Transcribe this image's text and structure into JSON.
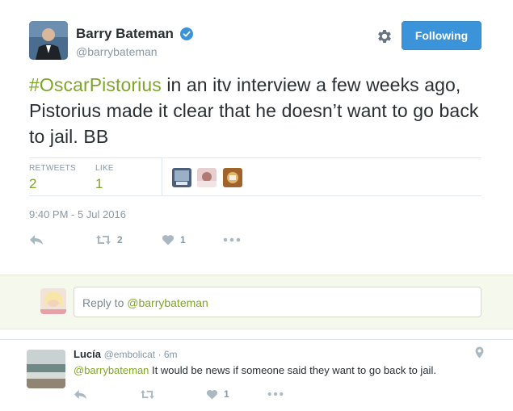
{
  "author": {
    "name": "Barry Bateman",
    "handle": "@barrybateman",
    "verified": true,
    "follow_label": "Following"
  },
  "tweet": {
    "hashtag": "#OscarPistorius",
    "text": " in an itv interview a few weeks ago, Pistorius made it clear that he doesn’t want to go back to jail. BB",
    "timestamp": "9:40 PM - 5 Jul 2016"
  },
  "stats": {
    "retweets_label": "RETWEETS",
    "retweets": "2",
    "likes_label": "LIKE",
    "likes": "1"
  },
  "actions": {
    "retweet_count": "2",
    "like_count": "1"
  },
  "reply_box": {
    "prefix": "Reply to ",
    "mention": "@barrybateman"
  },
  "reply": {
    "name": "Lucía",
    "handle": "@embolicat",
    "separator": " · ",
    "time": "6m",
    "mention": "@barrybateman",
    "text": " It would be news if someone said they want to go back to jail.",
    "like_count": "1"
  },
  "colors": {
    "accent_green": "#7fa52a",
    "follow_blue": "#3b94d9",
    "muted": "#8899a6"
  }
}
